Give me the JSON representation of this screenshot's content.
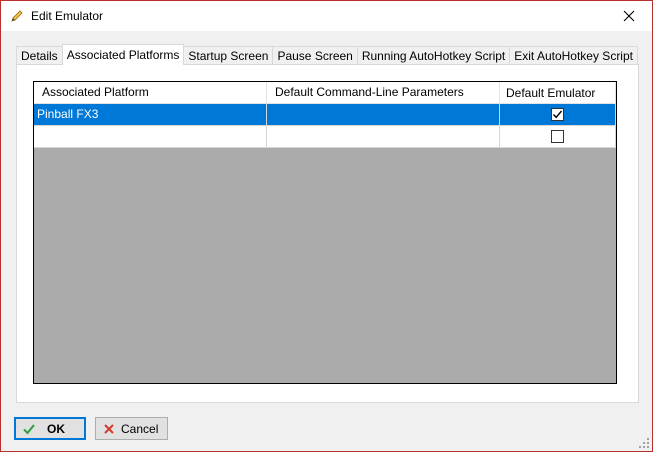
{
  "window": {
    "title": "Edit Emulator",
    "title_icon": "pencil-icon",
    "close_icon": "close-icon"
  },
  "tabs": [
    {
      "label": "Details",
      "active": false
    },
    {
      "label": "Associated Platforms",
      "active": true
    },
    {
      "label": "Startup Screen",
      "active": false
    },
    {
      "label": "Pause Screen",
      "active": false
    },
    {
      "label": "Running AutoHotkey Script",
      "active": false
    },
    {
      "label": "Exit AutoHotkey Script",
      "active": false
    }
  ],
  "grid": {
    "columns": [
      "Associated Platform",
      "Default Command-Line Parameters",
      "Default Emulator"
    ],
    "rows": [
      {
        "platform": "Pinball FX3",
        "params": "",
        "default_emulator": true,
        "selected": true
      },
      {
        "platform": "",
        "params": "",
        "default_emulator": false,
        "selected": false
      }
    ]
  },
  "buttons": {
    "ok_label": "OK",
    "ok_icon": "checkmark-icon",
    "cancel_label": "Cancel",
    "cancel_icon": "x-icon"
  },
  "colors": {
    "selection": "#0078d7",
    "grid_background": "#ababab",
    "window_border": "#b8312f"
  }
}
